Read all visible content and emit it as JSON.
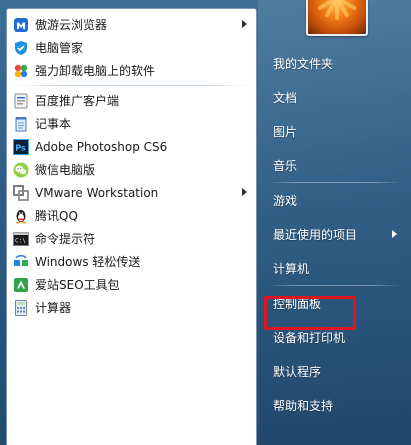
{
  "programs": [
    {
      "label": "傲游云浏览器",
      "icon": "maxthon-browser-icon",
      "has_submenu": true,
      "group": "pinned"
    },
    {
      "label": "电脑管家",
      "icon": "pc-manager-shield-icon",
      "has_submenu": false,
      "group": "pinned"
    },
    {
      "label": "强力卸载电脑上的软件",
      "icon": "uninstaller-pinwheel-icon",
      "has_submenu": false,
      "group": "pinned"
    },
    {
      "label": "百度推广客户端",
      "icon": "baidu-promotion-client-icon",
      "has_submenu": false,
      "group": "recent"
    },
    {
      "label": "记事本",
      "icon": "notepad-icon",
      "has_submenu": false,
      "group": "recent"
    },
    {
      "label": "Adobe Photoshop CS6",
      "icon": "photoshop-icon",
      "has_submenu": false,
      "group": "recent"
    },
    {
      "label": "微信电脑版",
      "icon": "wechat-icon",
      "has_submenu": false,
      "group": "recent"
    },
    {
      "label": "VMware Workstation",
      "icon": "vmware-icon",
      "has_submenu": true,
      "group": "recent"
    },
    {
      "label": "腾讯QQ",
      "icon": "qq-penguin-icon",
      "has_submenu": false,
      "group": "recent"
    },
    {
      "label": "命令提示符",
      "icon": "command-prompt-icon",
      "has_submenu": false,
      "group": "recent"
    },
    {
      "label": "Windows 轻松传送",
      "icon": "windows-easy-transfer-icon",
      "has_submenu": false,
      "group": "recent"
    },
    {
      "label": "爱站SEO工具包",
      "icon": "aizhan-seo-icon",
      "has_submenu": false,
      "group": "recent"
    },
    {
      "label": "计算器",
      "icon": "calculator-icon",
      "has_submenu": false,
      "group": "recent"
    }
  ],
  "right_menu": [
    {
      "label": "我的文件夹",
      "has_submenu": false
    },
    {
      "label": "文档",
      "has_submenu": false
    },
    {
      "label": "图片",
      "has_submenu": false
    },
    {
      "label": "音乐",
      "has_submenu": false
    },
    {
      "label": "游戏",
      "has_submenu": false
    },
    {
      "label": "最近使用的项目",
      "has_submenu": true
    },
    {
      "label": "计算机",
      "has_submenu": false
    },
    {
      "label": "控制面板",
      "has_submenu": false,
      "highlighted": true
    },
    {
      "label": "设备和打印机",
      "has_submenu": false
    },
    {
      "label": "默认程序",
      "has_submenu": false
    },
    {
      "label": "帮助和支持",
      "has_submenu": false
    }
  ],
  "right_separators_after": [
    3,
    6
  ],
  "user_picture": {
    "icon": "user-picture-flower"
  },
  "colors": {
    "menu_background": "#2f5e86",
    "left_pane": "#ffffff",
    "highlight_border": "#e0141e",
    "right_text": "#ffffff"
  }
}
